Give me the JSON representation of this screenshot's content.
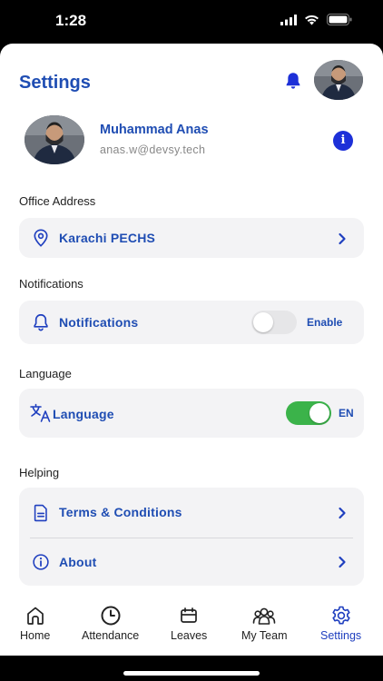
{
  "status_bar": {
    "time": "1:28"
  },
  "header": {
    "title": "Settings"
  },
  "profile": {
    "name": "Muhammad Anas",
    "email": "anas.w@devsy.tech"
  },
  "office": {
    "section_label": "Office Address",
    "value": "Karachi PECHS"
  },
  "notifications": {
    "section_label": "Notifications",
    "label": "Notifications",
    "toggle_state": "off",
    "toggle_text": "Enable"
  },
  "language": {
    "section_label": "Language",
    "label": "Language",
    "toggle_state": "on",
    "toggle_text": "EN"
  },
  "helping": {
    "section_label": "Helping",
    "items": [
      {
        "label": "Terms & Conditions",
        "icon": "document-icon"
      },
      {
        "label": "About",
        "icon": "info-circle-icon"
      }
    ]
  },
  "tabbar": {
    "items": [
      {
        "label": "Home",
        "icon": "home-icon"
      },
      {
        "label": "Attendance",
        "icon": "clock-icon"
      },
      {
        "label": "Leaves",
        "icon": "calendar-icon"
      },
      {
        "label": "My Team",
        "icon": "team-icon"
      },
      {
        "label": "Settings",
        "icon": "gear-icon",
        "active": true
      }
    ]
  },
  "colors": {
    "accent": "#1f4db3",
    "toggle_on": "#3bb34a",
    "card_bg": "#f3f3f5"
  }
}
